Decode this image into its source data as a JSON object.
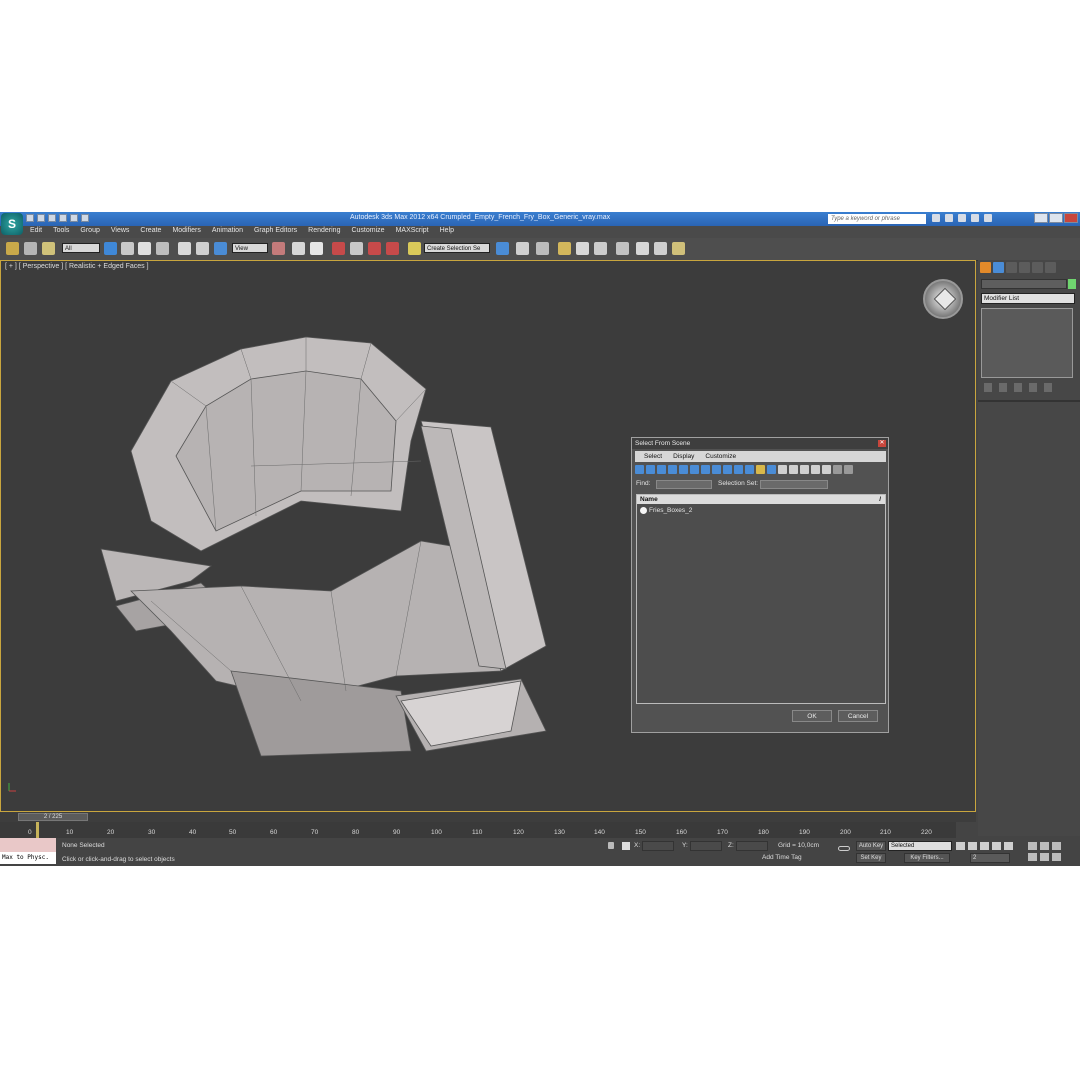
{
  "window": {
    "title": "Autodesk 3ds Max  2012 x64     Crumpled_Empty_French_Fry_Box_Generic_vray.max",
    "search_placeholder": "Type a keyword or phrase"
  },
  "menubar": [
    "Edit",
    "Tools",
    "Group",
    "Views",
    "Create",
    "Modifiers",
    "Animation",
    "Graph Editors",
    "Rendering",
    "Customize",
    "MAXScript",
    "Help"
  ],
  "toolbar": {
    "selection_filter": "All",
    "reference_coord": "View",
    "named_selection": "Create Selection Se"
  },
  "viewport": {
    "label": "[ + ] [ Perspective ] [ Realistic + Edged Faces ]"
  },
  "dialog": {
    "title": "Select From Scene",
    "menu": [
      "Select",
      "Display",
      "Customize"
    ],
    "find_label": "Find:",
    "selection_set_label": "Selection Set:",
    "column_header": "Name",
    "column_sort": "/",
    "objects": [
      "Fries_Boxes_2"
    ],
    "ok_label": "OK",
    "cancel_label": "Cancel"
  },
  "command_panel": {
    "modifier_list": "Modifier List"
  },
  "timeline": {
    "frame_indicator": "2 / 225",
    "ticks": [
      "0",
      "10",
      "20",
      "30",
      "40",
      "50",
      "60",
      "70",
      "80",
      "90",
      "100",
      "110",
      "120",
      "130",
      "140",
      "150",
      "160",
      "170",
      "180",
      "190",
      "200",
      "210",
      "220"
    ]
  },
  "status": {
    "maxscript_listener": "Max to Physc.",
    "selection": "None Selected",
    "prompt": "Click or click-and-drag to select objects",
    "x_label": "X:",
    "y_label": "Y:",
    "z_label": "Z:",
    "grid": "Grid = 10,0cm",
    "add_time_tag": "Add Time Tag",
    "auto_key": "Auto Key",
    "set_key": "Set Key",
    "key_mode": "Selected",
    "key_filters": "Key Filters...",
    "current_frame": "2"
  },
  "colors": {
    "accent_title": "#3a7fd0",
    "viewport_border": "#c9a63e",
    "object_color": "#6fd56f"
  }
}
